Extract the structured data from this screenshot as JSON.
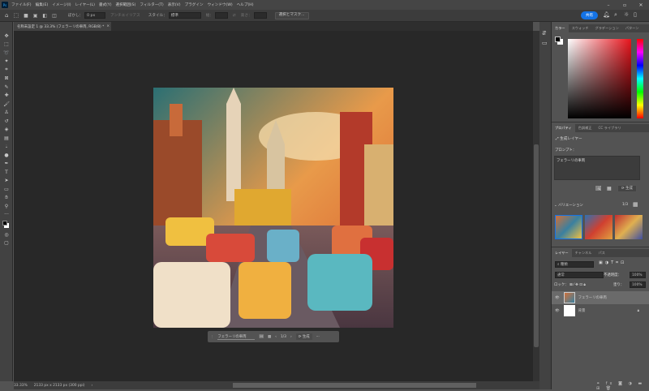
{
  "menu": [
    "ファイル(F)",
    "編集(E)",
    "イメージ(I)",
    "レイヤー(L)",
    "書式(Y)",
    "選択範囲(S)",
    "フィルター(T)",
    "表示(V)",
    "プラグイン",
    "ウィンドウ(W)",
    "ヘルプ(H)"
  ],
  "app_icon": "Ps",
  "options": {
    "feather_label": "ぼかし：",
    "feather_value": "0 px",
    "antialias": "アンチエイリアス",
    "style_label": "スタイル：",
    "style_value": "標準",
    "width_label": "幅：",
    "height_label": "高さ：",
    "select_mask": "選択とマスク..."
  },
  "share": "共有",
  "document_tab": {
    "title": "名称未設定 1 @ 33.3% (フェラーリの車両, RGB/8) *",
    "close": "×"
  },
  "context_bar": {
    "prompt": "フェラーリの車両",
    "page": "1/3",
    "generate": "生成",
    "more": "···"
  },
  "status": {
    "zoom": "33.33%",
    "size": "2133 px x 2133 px (300 ppi)",
    "arrow": "›"
  },
  "color_panel": {
    "tabs": [
      "カラー",
      "スウォッチ",
      "グラデーション",
      "パターン"
    ],
    "accent": "#e8141c"
  },
  "properties_panel": {
    "tabs": [
      "プロパティ",
      "色調補正",
      "CC ライブラリ"
    ],
    "layer_type": "生成レイヤー",
    "prompt_label": "プロンプト：",
    "prompt_value": "フェラーリの車両",
    "generate": "生成",
    "variations_label": "バリエーション",
    "variations_page": "1/3"
  },
  "layers_panel": {
    "tabs": [
      "レイヤー",
      "チャンネル",
      "パス"
    ],
    "filter": "種類",
    "blend": "通常",
    "opacity_label": "不透明度：",
    "opacity": "100%",
    "lock_label": "ロック：",
    "fill_label": "塗り：",
    "fill": "100%",
    "layers": [
      {
        "name": "フェラーリの車両",
        "selected": true
      },
      {
        "name": "背景",
        "selected": false
      }
    ]
  },
  "colors": {
    "share": "#1473e6",
    "canvas_bg": "#282828"
  }
}
